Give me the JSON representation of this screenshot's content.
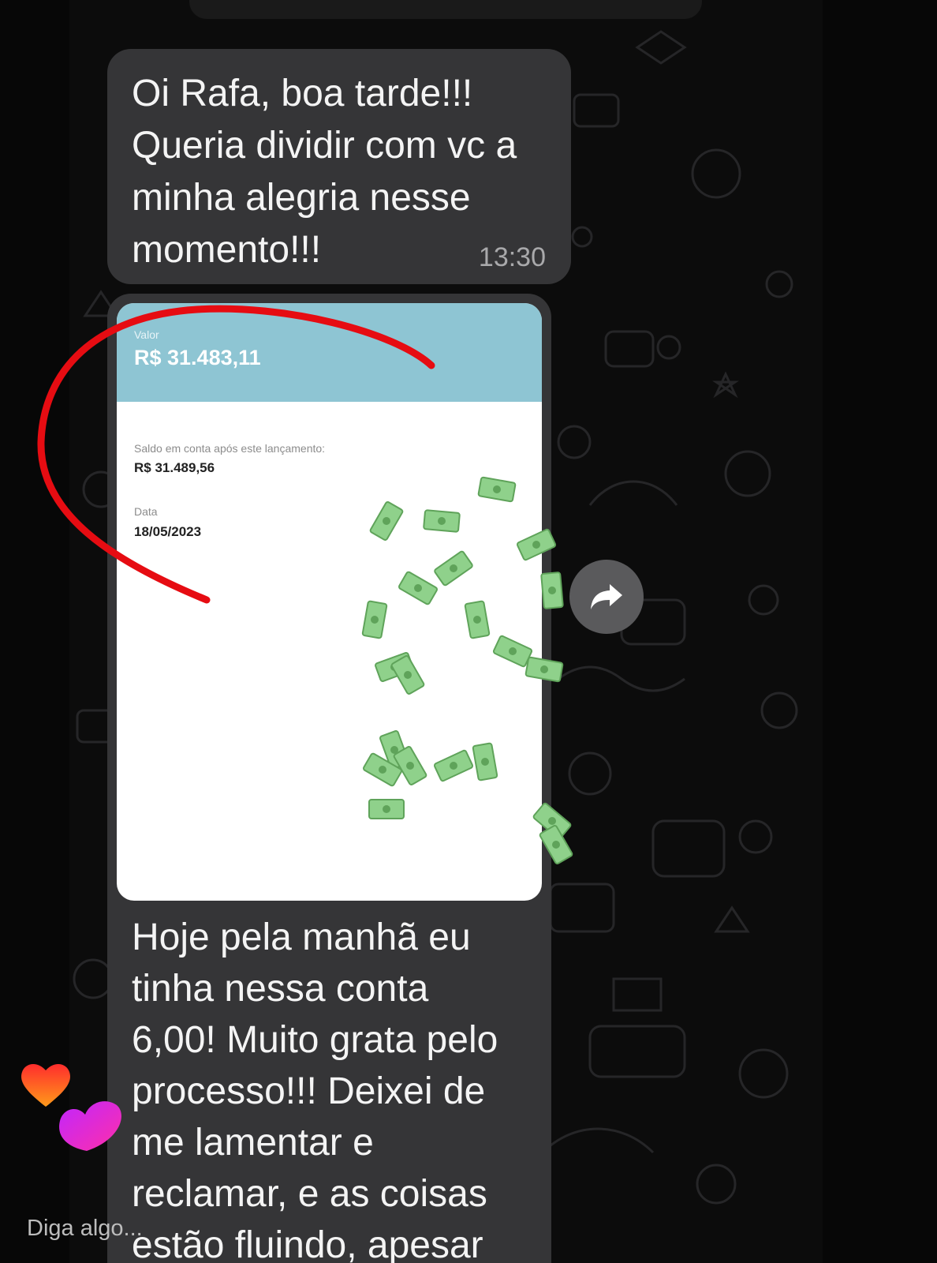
{
  "messages": {
    "first": {
      "text": "Oi Rafa, boa tarde!!!\nQueria dividir com vc a\nminha alegria nesse\nmomento!!!",
      "time": "13:30"
    },
    "receipt": {
      "valor_label": "Valor",
      "valor_value": "R$ 31.483,11",
      "saldo_label": "Saldo em conta após este lançamento:",
      "saldo_value": "R$ 31.489,56",
      "data_label": "Data",
      "data_value": "18/05/2023"
    },
    "second": {
      "text": "Hoje pela manhã eu\ntinha nessa conta\n6,00! Muito grata pelo\nprocesso!!! Deixei de\nme lamentar e\nreclamar, e as coisas\nestão fluindo, apesar"
    }
  },
  "live": {
    "comment_placeholder": "Diga algo..."
  },
  "icons": {
    "forward": "forward-arrow-icon",
    "reactions": [
      "heart-icon",
      "heart-icon"
    ],
    "effects": [
      "money-bill-icon"
    ],
    "annotation": "red-marker-stroke"
  },
  "colors": {
    "bubble": "#353537",
    "receipt_header": "#8ec5d3",
    "marker": "#e60c12",
    "money": "#8fd18b"
  }
}
